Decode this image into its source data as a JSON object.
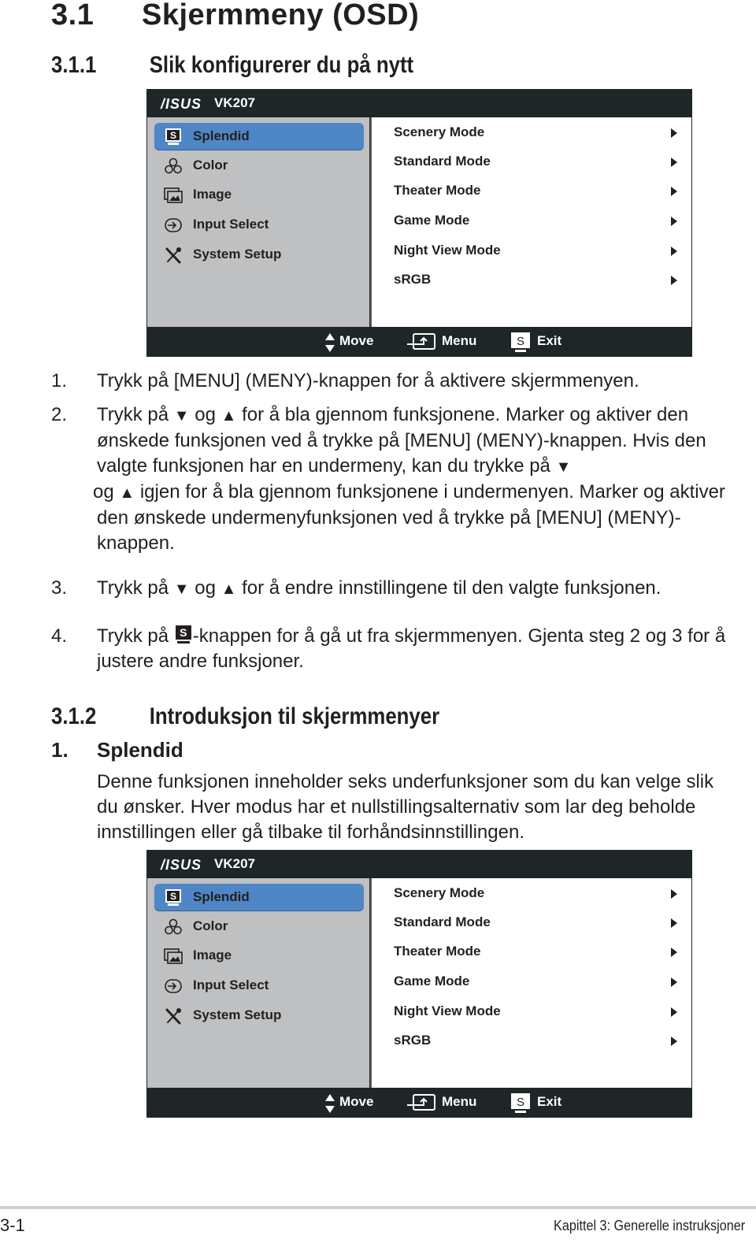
{
  "heading1": {
    "number": "3.1",
    "title": "Skjermmeny (OSD)"
  },
  "heading2a": {
    "number": "3.1.1",
    "title": "Slik konfigurerer du på nytt"
  },
  "osd": {
    "brand": "/ISUS",
    "model": "VK207",
    "menu_items": [
      {
        "label": "Splendid",
        "icon": "splendid-s-icon",
        "selected": true
      },
      {
        "label": "Color",
        "icon": "rgb-color-icon",
        "selected": false
      },
      {
        "label": "Image",
        "icon": "image-icon",
        "selected": false
      },
      {
        "label": "Input Select",
        "icon": "input-select-icon",
        "selected": false
      },
      {
        "label": "System Setup",
        "icon": "wrench-screwdriver-icon",
        "selected": false
      }
    ],
    "submenu_items": [
      {
        "label": "Scenery Mode",
        "icon": "chevron-right-icon"
      },
      {
        "label": "Standard Mode",
        "icon": "chevron-right-icon"
      },
      {
        "label": "Theater Mode",
        "icon": "chevron-right-icon"
      },
      {
        "label": "Game Mode",
        "icon": "chevron-right-icon"
      },
      {
        "label": "Night View Mode",
        "icon": "chevron-right-icon"
      },
      {
        "label": "sRGB",
        "icon": "chevron-right-icon"
      }
    ],
    "footer": {
      "move": "Move",
      "menu": "Menu",
      "exit": "Exit",
      "exit_key": "S"
    },
    "colors": {
      "frame": "#1e2628",
      "left_panel": "#bfc0c2",
      "selected": "#4f86c6",
      "right_panel": "#ffffff"
    }
  },
  "steps": [
    {
      "n": "1.",
      "text": "Trykk på [MENU] (MENY)-knappen for å aktivere skjermmenyen."
    },
    {
      "n": "2.",
      "line1a": "Trykk på ",
      "down": "▼",
      "og": " og ",
      "up": "▲",
      "line1b": " for å bla gjennom funksjonene. Marker og aktiver den ønskede funksjonen ved å trykke på [MENU] (MENY)-knappen. Hvis den valgte funksjonen har en undermeny, kan du trykke på ",
      "line2": " igjen for å bla gjennom funksjonene i undermenyen. Marker og aktiver den ønskede undermenyfunksjonen ved å trykke på [MENU] (MENY)-knappen."
    },
    {
      "n": "3.",
      "a": "Trykk på ",
      "down": "▼",
      "og": " og ",
      "up": "▲",
      "b": " for å endre innstillingene til den valgte funksjonen."
    },
    {
      "n": "4.",
      "a": "Trykk på ",
      "key": "S",
      "b": "-knappen for å gå ut fra skjermmenyen. Gjenta steg 2 og 3 for å justere andre funksjoner."
    }
  ],
  "heading2b": {
    "number": "3.1.2",
    "title": "Introduksjon til skjermmenyer"
  },
  "section": {
    "n": "1.",
    "title": "Splendid",
    "body": "Denne funksjonen inneholder seks underfunksjoner som du kan velge slik du ønsker. Hver modus har et nullstillingsalternativ som lar deg beholde innstillingen eller gå tilbake til forhåndsinnstillingen."
  },
  "footer": {
    "page": "3-1",
    "chapter": "Kapittel 3: Generelle instruksjoner"
  }
}
